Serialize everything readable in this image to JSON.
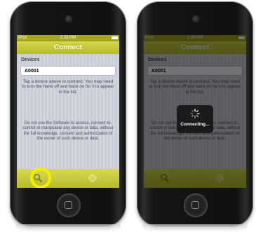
{
  "status_bar": {
    "carrier": "iPod",
    "time": "2:33 PM"
  },
  "nav": {
    "title": "Connect"
  },
  "devices": {
    "section_title": "Devices",
    "items": [
      "A0001"
    ]
  },
  "hint_text": "Tap a device above to connect. You may need to turn the hand off and back on for it to appear in the list.",
  "legal_text": "Do not use the Software to access, connect to, control or manipulate any device or data, without the full knowledge, consent and authorization of the owner of such device or data.",
  "tabs": [
    {
      "icon": "search-icon"
    },
    {
      "icon": "gear-icon"
    }
  ],
  "progress": {
    "label": "Connecting..."
  },
  "colors": {
    "accent": "#c4ca3a",
    "highlight": "#f4ee00",
    "status_bar": "#a5a51e"
  }
}
